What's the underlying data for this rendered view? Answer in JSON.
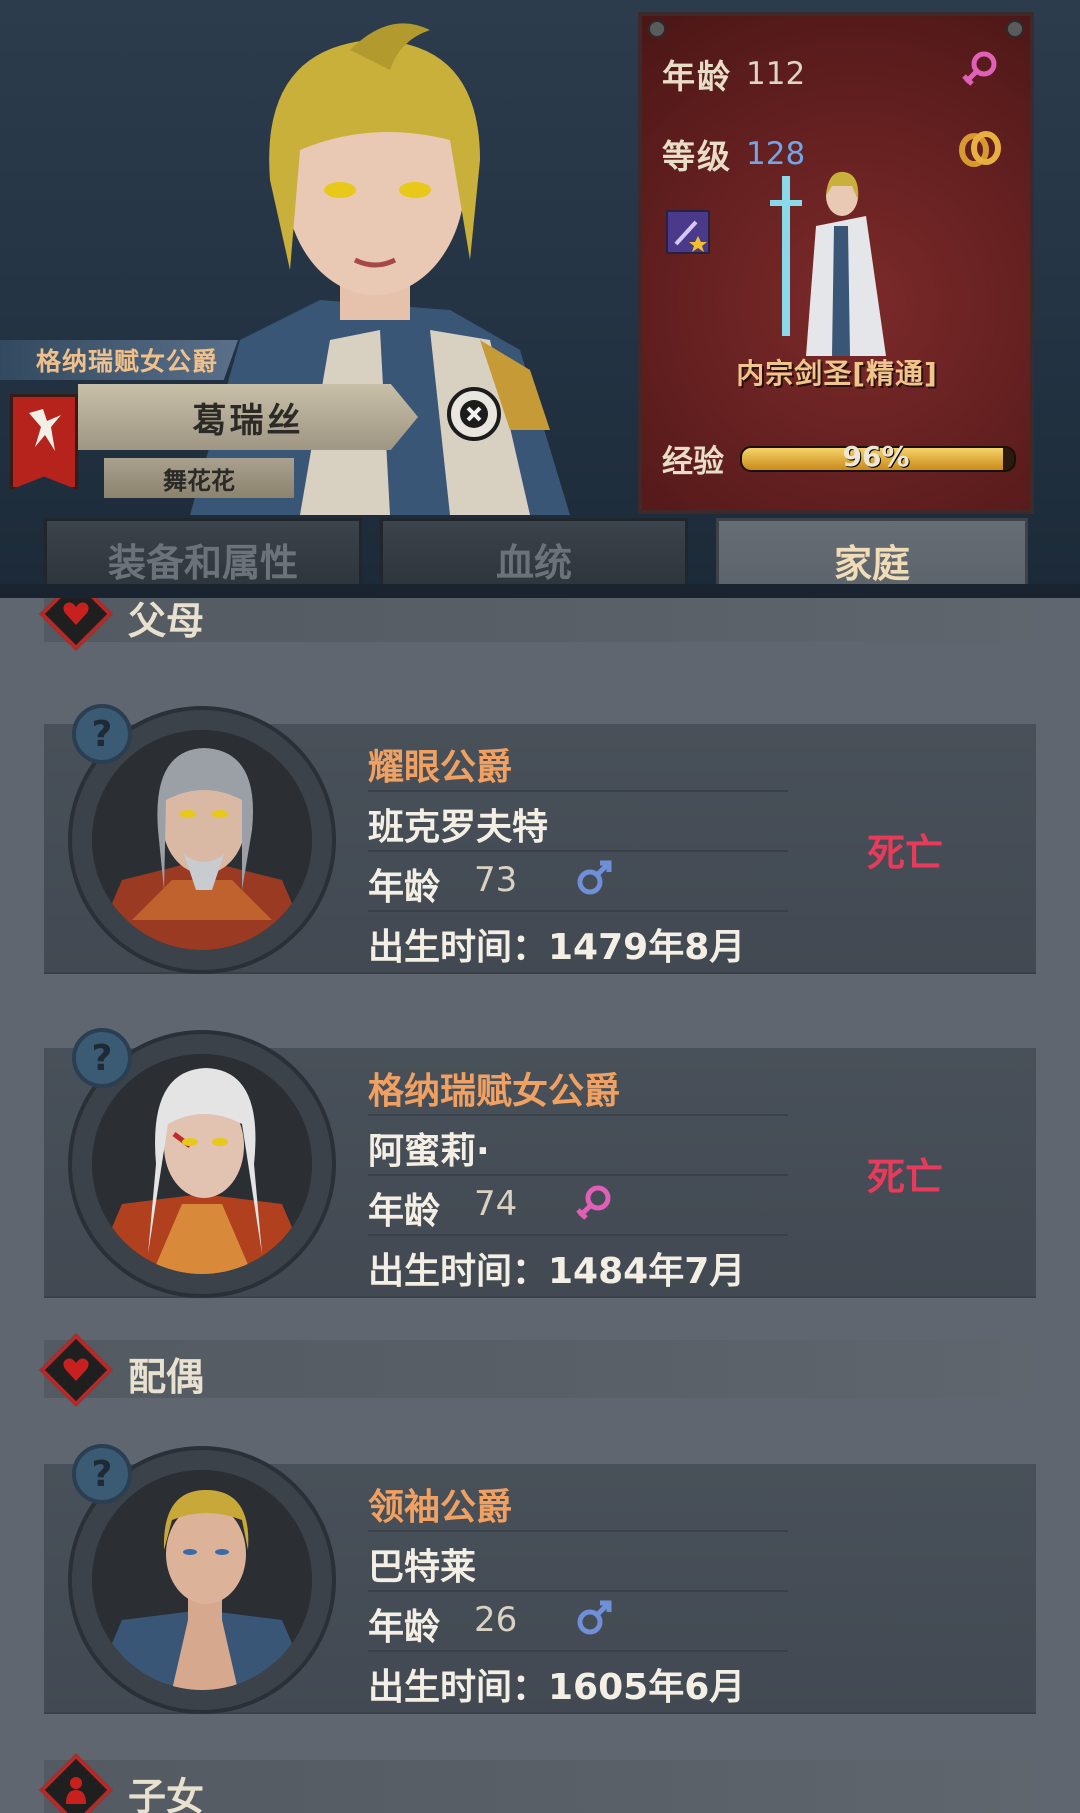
{
  "header": {
    "title_ribbon": "格纳瑞赋女公爵",
    "character_name": "葛瑞丝",
    "character_subname": "舞花花",
    "stats": {
      "age_label": "年龄",
      "age_value": "112",
      "level_label": "等级",
      "level_value": "128",
      "class_name": "内宗剑圣[精通]",
      "exp_label": "经验",
      "exp_percent": "96%",
      "exp_fraction": 0.96
    }
  },
  "tabs": [
    {
      "label": "装备和属性"
    },
    {
      "label": "血统"
    },
    {
      "label": "家庭"
    }
  ],
  "sections": {
    "parents": "父母",
    "spouse": "配偶",
    "children": "子女"
  },
  "cards": [
    {
      "title": "耀眼公爵",
      "name": "班克罗夫特",
      "age_label": "年龄",
      "age": "73",
      "gender": "male",
      "birth": "出生时间：1479年8月",
      "status": "死亡"
    },
    {
      "title": "格纳瑞赋女公爵",
      "name": "阿蜜莉·",
      "age_label": "年龄",
      "age": "74",
      "gender": "female",
      "birth": "出生时间：1484年7月",
      "status": "死亡"
    },
    {
      "title": "领袖公爵",
      "name": "巴特莱",
      "age_label": "年龄",
      "age": "26",
      "gender": "male",
      "birth": "出生时间：1605年6月",
      "status": ""
    }
  ],
  "colors": {
    "male": "#6f8fd6",
    "female": "#e060b8",
    "dead": "#e83a5a",
    "title_orange": "#f0a060"
  }
}
